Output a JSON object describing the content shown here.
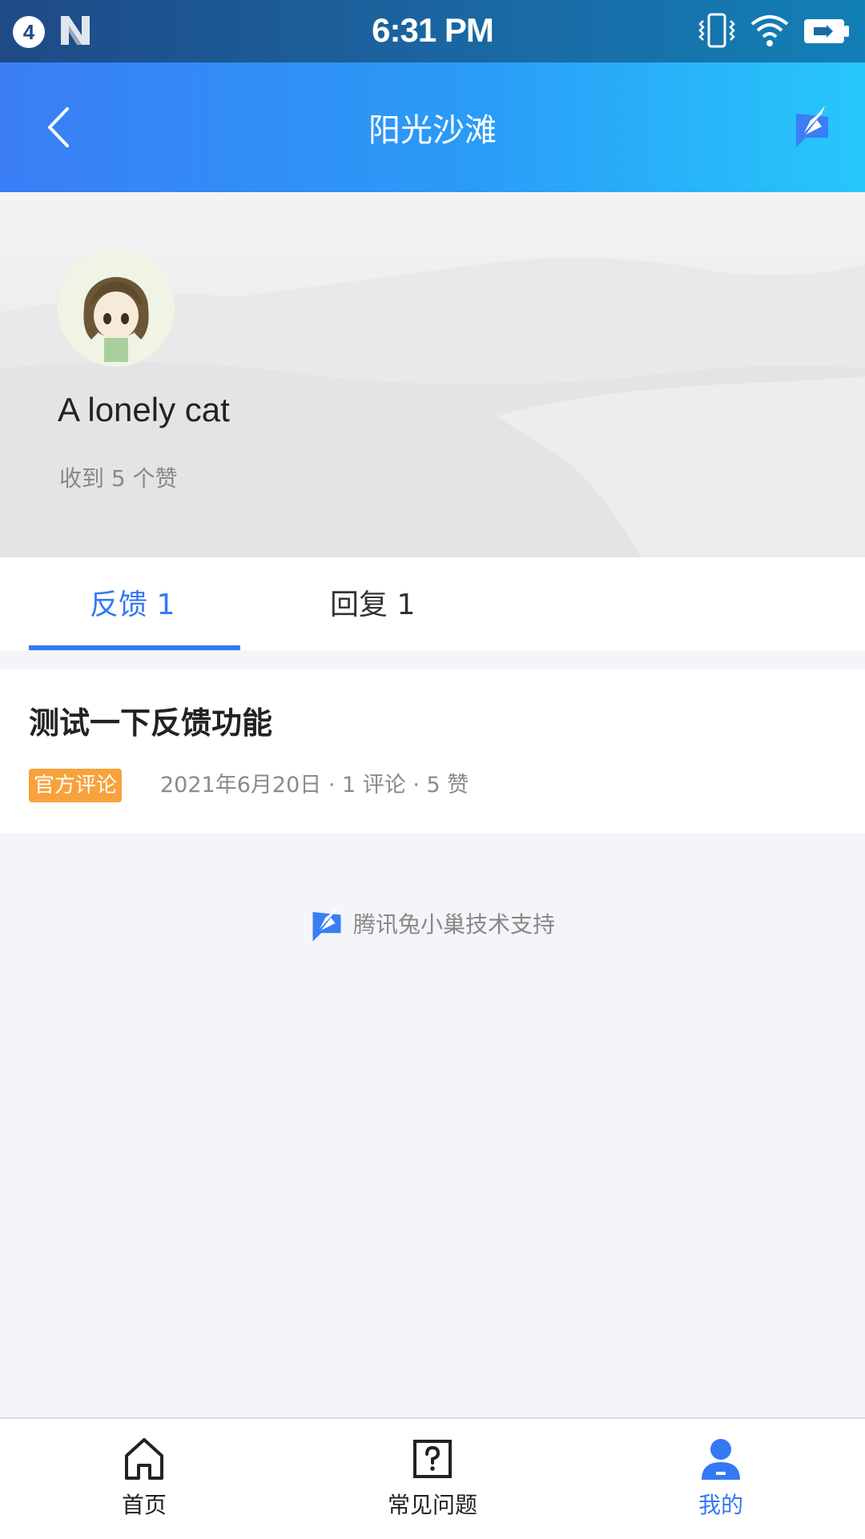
{
  "status_bar": {
    "notification_count": "4",
    "time": "6:31 PM"
  },
  "header": {
    "title": "阳光沙滩"
  },
  "profile": {
    "username": "A lonely cat",
    "likes_text": "收到 5 个赞"
  },
  "tabs": [
    {
      "label": "反馈  1",
      "active": true
    },
    {
      "label": "回复  1",
      "active": false
    }
  ],
  "post": {
    "title": "测试一下反馈功能",
    "tag": "官方评论",
    "meta": "2021年6月20日 · 1 评论 · 5 赞"
  },
  "footer": {
    "support_text": "腾讯兔小巢技术支持"
  },
  "bottom_nav": [
    {
      "label": "首页",
      "icon": "home-icon",
      "active": false
    },
    {
      "label": "常见问题",
      "icon": "question-icon",
      "active": false
    },
    {
      "label": "我的",
      "icon": "person-icon",
      "active": true
    }
  ],
  "colors": {
    "accent": "#3478f6",
    "tag": "#f7a23b"
  }
}
